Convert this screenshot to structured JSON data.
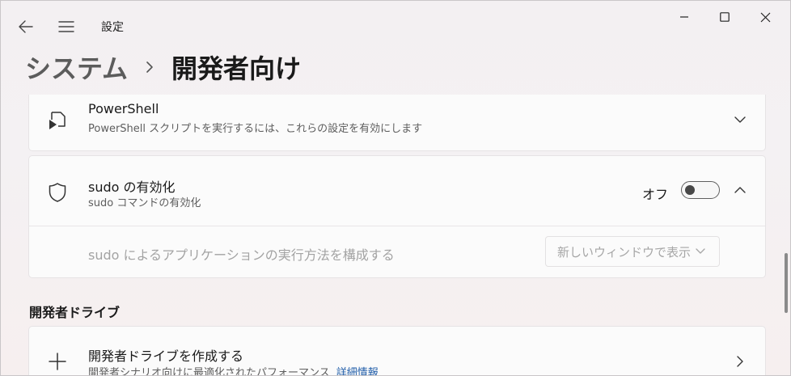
{
  "window": {
    "app_title": "設定",
    "back_icon": "arrow-left-icon",
    "menu_icon": "hamburger-icon",
    "controls": [
      "minimize-icon",
      "maximize-icon",
      "close-icon"
    ]
  },
  "breadcrumb": {
    "parent": "システム",
    "separator_icon": "chevron-right-icon",
    "current": "開発者向け"
  },
  "powershell": {
    "icon": "powershell-icon",
    "title": "PowerShell",
    "subtitle": "PowerShell スクリプトを実行するには、これらの設定を有効にします",
    "expand_icon": "chevron-down-icon"
  },
  "sudo": {
    "icon": "shield-icon",
    "title": "sudo の有効化",
    "subtitle": "sudo コマンドの有効化",
    "toggle_label": "オフ",
    "toggle_on": false,
    "collapse_icon": "chevron-up-icon",
    "mode_label": "sudo によるアプリケーションの実行方法を構成する",
    "mode_value": "新しいウィンドウで表示",
    "mode_enabled": false
  },
  "dev_drive": {
    "heading": "開発者ドライブ",
    "icon": "plus-icon",
    "title": "開発者ドライブを作成する",
    "subtitle": "開発者シナリオ向けに最適化されたパフォーマンス",
    "link": "詳細情報",
    "go_icon": "chevron-right-icon"
  },
  "colors": {
    "accent_link": "#1f5ca8",
    "background": "#f3f0f2",
    "card": "#fbfbfb"
  }
}
